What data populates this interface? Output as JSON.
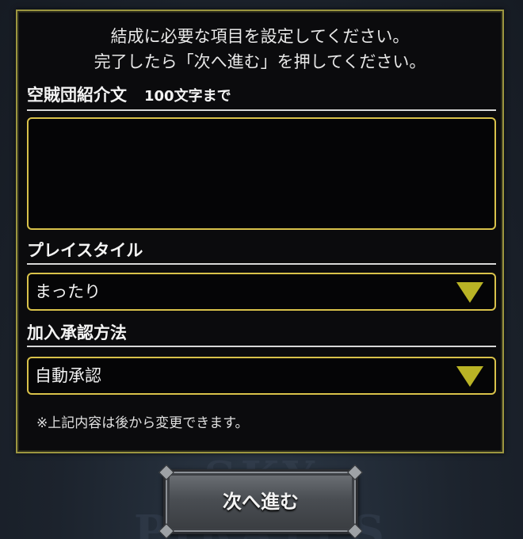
{
  "intro": {
    "line1": "結成に必要な項目を設定してください。",
    "line2": "完了したら「次へ進む」を押してください。"
  },
  "intro_text": {
    "label": "空賊団紹介文",
    "limit": "100文字まで",
    "value": ""
  },
  "play_style": {
    "label": "プレイスタイル",
    "selected": "まったり",
    "icon": "triangle-down-icon"
  },
  "join_approval": {
    "label": "加入承認方法",
    "selected": "自動承認",
    "icon": "triangle-down-icon"
  },
  "note": "※上記内容は後から変更できます。",
  "next_button": {
    "label": "次へ進む"
  },
  "colors": {
    "panel_border": "#9c9640",
    "field_border": "#d9c24a",
    "arrow": "#b9b325",
    "panel_bg": "#0b0b0d"
  }
}
